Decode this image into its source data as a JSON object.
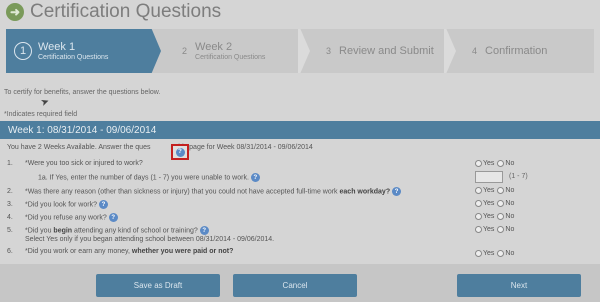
{
  "title": "Certification Questions",
  "steps": [
    {
      "number": "1",
      "label": "Week 1",
      "sublabel": "Certification Questions"
    },
    {
      "number": "2",
      "label": "Week 2",
      "sublabel": "Certification Questions"
    },
    {
      "number": "3",
      "label": "Review and Submit",
      "sublabel": ""
    },
    {
      "number": "4",
      "label": "Confirmation",
      "sublabel": ""
    }
  ],
  "intro_text": "To certify for benefits, answer the questions below.",
  "required_note": "*Indicates required field",
  "week_header": "Week 1: 08/31/2014 - 09/06/2014",
  "availability_text_a": "You have 2 Weeks Available. Answer the ques",
  "availability_text_b": "n this page for Week 08/31/2014 - 09/06/2014",
  "radio_labels": {
    "yes": "Yes",
    "no": "No"
  },
  "questions": [
    {
      "number": "1.",
      "text": "*Were you too sick or injured to work?"
    },
    {
      "number": "",
      "text": "1a. If Yes, enter the number of days (1 - 7) you were unable to work."
    },
    {
      "number": "2.",
      "text": "*Was there any reason (other than sickness or injury) that you could not have accepted full-time work",
      "bold": "each workday?"
    },
    {
      "number": "3.",
      "text": "*Did you look for work?"
    },
    {
      "number": "4.",
      "text": "*Did you refuse any work?"
    },
    {
      "number": "5.",
      "text_pre": "*Did you",
      "bold": "begin",
      "text_post": "attending any kind of school or training?"
    },
    {
      "number": "",
      "text": "Select Yes only if you began attending school between 08/31/2014 - 09/06/2014."
    },
    {
      "number": "6.",
      "text": "*Did you work or earn any money,",
      "bold": "whether you were paid or not?"
    }
  ],
  "days_hint": "(1 - 7)",
  "buttons": {
    "save_draft": "Save as Draft",
    "cancel": "Cancel",
    "next": "Next"
  },
  "colors": {
    "accent": "#4e7e9e",
    "highlight_border": "#c42020",
    "help_icon": "#5b8ac6"
  }
}
